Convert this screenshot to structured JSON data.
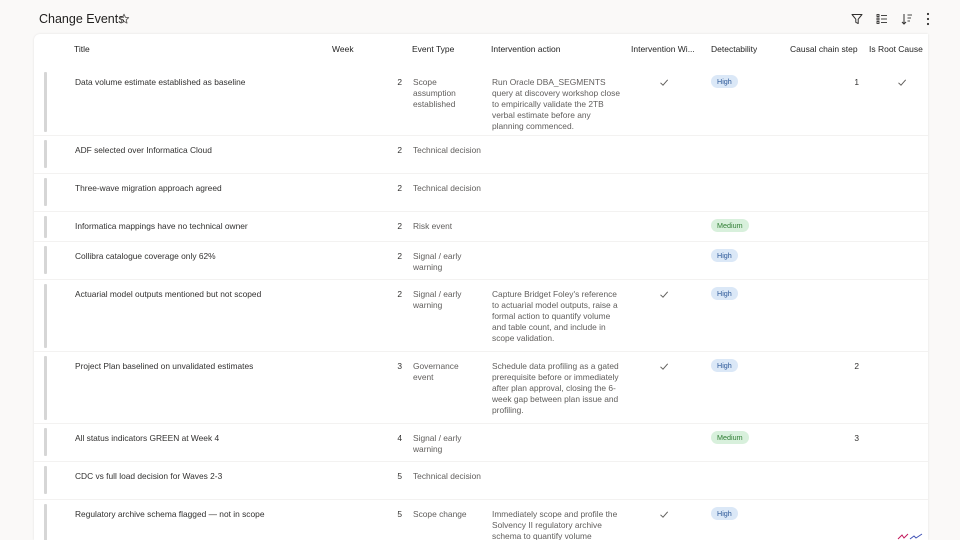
{
  "header": {
    "title": "Change Events"
  },
  "columns": {
    "title": "Title",
    "week": "Week",
    "event_type": "Event Type",
    "intervention_action": "Intervention action",
    "intervention_window": "Intervention Wi...",
    "detectability": "Detectability",
    "causal_chain_step": "Causal chain step",
    "is_root_cause": "Is Root Cause"
  },
  "colors": {
    "high_badge_bg": "#dbe8f7",
    "high_badge_text": "#2b5797",
    "medium_badge_bg": "#d8f0dc",
    "medium_badge_text": "#2e7d32",
    "accent": "#605e5c"
  },
  "icons": [
    "star-icon",
    "filter-icon",
    "columns-icon",
    "sort-icon",
    "more-icon",
    "checkmark-icon"
  ],
  "rows": [
    {
      "title": "Data volume estimate established as baseline",
      "week": "2",
      "event_type": "Scope assumption established",
      "intervention_action": "Run Oracle DBA_SEGMENTS query at discovery workshop close to empirically validate the 2TB verbal estimate before any planning commenced.",
      "intervention_window": true,
      "detectability": "High",
      "causal_chain_step": "1",
      "is_root_cause": true
    },
    {
      "title": "ADF selected over Informatica Cloud",
      "week": "2",
      "event_type": "Technical decision",
      "intervention_action": "",
      "intervention_window": false,
      "detectability": "",
      "causal_chain_step": "",
      "is_root_cause": false
    },
    {
      "title": "Three-wave migration approach agreed",
      "week": "2",
      "event_type": "Technical decision",
      "intervention_action": "",
      "intervention_window": false,
      "detectability": "",
      "causal_chain_step": "",
      "is_root_cause": false
    },
    {
      "title": "Informatica mappings have no technical owner",
      "week": "2",
      "event_type": "Risk event",
      "intervention_action": "",
      "intervention_window": false,
      "detectability": "Medium",
      "causal_chain_step": "",
      "is_root_cause": false
    },
    {
      "title": "Collibra catalogue coverage only 62%",
      "week": "2",
      "event_type": "Signal / early warning",
      "intervention_action": "",
      "intervention_window": false,
      "detectability": "High",
      "causal_chain_step": "",
      "is_root_cause": false
    },
    {
      "title": "Actuarial model outputs mentioned but not scoped",
      "week": "2",
      "event_type": "Signal / early warning",
      "intervention_action": "Capture Bridget Foley's reference to actuarial model outputs, raise a formal action to quantify volume and table count, and include in scope validation.",
      "intervention_window": true,
      "detectability": "High",
      "causal_chain_step": "",
      "is_root_cause": false
    },
    {
      "title": "Project Plan baselined on unvalidated estimates",
      "week": "3",
      "event_type": "Governance event",
      "intervention_action": "Schedule data profiling as a gated prerequisite before or immediately after plan approval, closing the 6-week gap between plan issue and profiling.",
      "intervention_window": true,
      "detectability": "High",
      "causal_chain_step": "2",
      "is_root_cause": false
    },
    {
      "title": "All status indicators GREEN at Week 4",
      "week": "4",
      "event_type": "Signal / early warning",
      "intervention_action": "",
      "intervention_window": false,
      "detectability": "Medium",
      "causal_chain_step": "3",
      "is_root_cause": false
    },
    {
      "title": "CDC vs full load decision for Waves 2-3",
      "week": "5",
      "event_type": "Technical decision",
      "intervention_action": "",
      "intervention_window": false,
      "detectability": "",
      "causal_chain_step": "",
      "is_root_cause": false
    },
    {
      "title": "Regulatory archive schema flagged — not in scope",
      "week": "5",
      "event_type": "Scope change",
      "intervention_action": "Immediately scope and profile the Solvency II regulatory archive schema to quantify volume",
      "intervention_window": true,
      "detectability": "High",
      "causal_chain_step": "",
      "is_root_cause": false
    }
  ]
}
